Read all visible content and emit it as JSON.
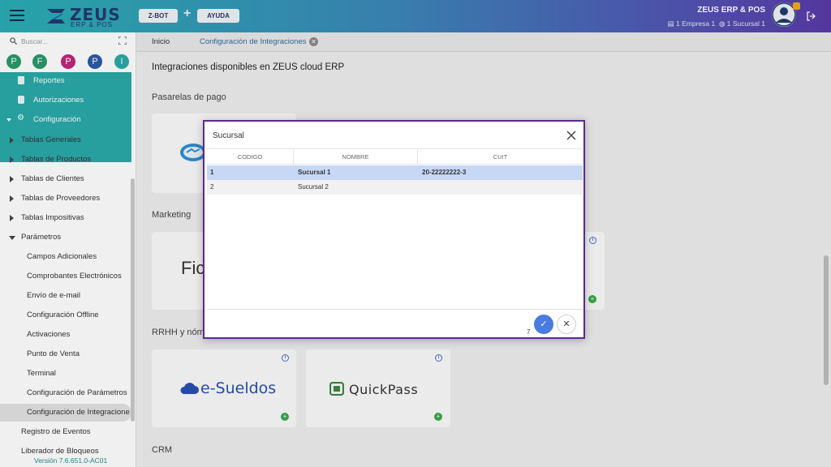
{
  "header": {
    "logo_text": "ZEUS",
    "logo_sub": "ERP & POS",
    "zbot_label": "Z-BOT",
    "plus": "+",
    "ayuda_label": "AYUDA",
    "user_name": "ZEUS ERP & POS",
    "empresa": "1 Empresa 1",
    "sucursal": "1 Sucursal 1"
  },
  "sidebar": {
    "search_placeholder": "Buscar...",
    "shortcuts": [
      {
        "letter": "P",
        "color": "#2a9a6a"
      },
      {
        "letter": "F",
        "color": "#2a9a6a"
      },
      {
        "letter": "P",
        "color": "#c0277a"
      },
      {
        "letter": "P",
        "color": "#2a5aa8"
      },
      {
        "letter": "I",
        "color": "#2aa9a8"
      }
    ],
    "teal_items": {
      "reportes": "Reportes",
      "autorizaciones": "Autorizaciones",
      "configuracion": "Configuración"
    },
    "items": {
      "tablas_generales": "Tablas Generales",
      "tablas_productos": "Tablas de Productos",
      "tablas_clientes": "Tablas de Clientes",
      "tablas_proveedores": "Tablas de Proveedores",
      "tablas_impositivas": "Tablas Impositivas",
      "parametros": "Parámetros",
      "registro_eventos": "Registro de Eventos",
      "liberador_bloqueos": "Liberador de Bloqueos"
    },
    "sub_items": {
      "campos_adicionales": "Campos Adicionales",
      "comprobantes": "Comprobantes Electrónicos",
      "envio_email": "Envío de e-mail",
      "config_offline": "Configuración Offline",
      "activaciones": "Activaciones",
      "punto_venta": "Punto de Venta",
      "terminal": "Terminal",
      "config_parametros": "Configuración de Parámetros",
      "config_integraciones": "Configuración de Integracione"
    },
    "version": "Versión 7.6.651.0-AC01"
  },
  "tabs": {
    "inicio": "Inicio",
    "active": "Configuración de Integraciones"
  },
  "main": {
    "title": "Integraciones disponibles en ZEUS cloud ERP",
    "sec_pago": "Pasarelas de pago",
    "sec_marketing": "Marketing",
    "sec_rrhh": "RRHH y nóm",
    "sec_crm": "CRM",
    "fic_text": "Fic",
    "esueldos": "e-Sueldos",
    "quickpass": "QuickPass"
  },
  "modal": {
    "title": "Sucursal",
    "columns": {
      "codigo": "CODIGO",
      "nombre": "NOMBRE",
      "cuit": "CUIT"
    },
    "rows": [
      {
        "codigo": "1",
        "nombre": "Sucursal 1",
        "cuit": "20-22222222-3"
      },
      {
        "codigo": "2",
        "nombre": "Sucursal 2",
        "cuit": ""
      }
    ],
    "count": "7"
  },
  "colors": {
    "accent_teal": "#2aa9a8",
    "modal_border": "#5a2a8c",
    "ok_blue": "#4a7be0",
    "selected_row": "#c6d8f6"
  }
}
